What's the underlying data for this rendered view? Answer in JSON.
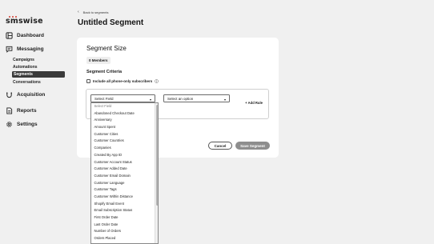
{
  "brand": {
    "logo_text": "smswise",
    "accent": "#d13b2f"
  },
  "sidebar": {
    "dashboard": "Dashboard",
    "messaging": "Messaging",
    "sub_items": [
      "Campaigns",
      "Automations",
      "Segments",
      "Conversations"
    ],
    "active_sub": "Segments",
    "acquisition": "Acquisition",
    "reports": "Reports",
    "settings": "Settings"
  },
  "header": {
    "back_label": "Back to segments",
    "title": "Untitled Segment"
  },
  "segment": {
    "size_title": "Segment Size",
    "members_badge": "0 Members",
    "criteria_title": "Segment Criteria",
    "phone_only_label": "Include all phone-only subscribers",
    "phone_only_checked": false,
    "field_select_value": "Select Field",
    "option_select_value": "Select an option",
    "add_rule_label": "+ Add Rule",
    "cancel_label": "Cancel",
    "save_label": "Save Segment"
  },
  "dropdown": {
    "options": [
      "Select Field",
      "Abandoned Checkout Date",
      "Anniversary",
      "Amount Spent",
      "Customer Cities",
      "Customer Countries",
      "Companies",
      "Created By App ID",
      "Customer Account Status",
      "Customer Added Date",
      "Customer Email Domain",
      "Customer Language",
      "Customer Tags",
      "Customer Within Distance",
      "Shopify Email Event",
      "Email Subscription Status",
      "First Order Date",
      "Last Order Date",
      "Number of Orders",
      "Orders Placed"
    ]
  },
  "icons": {
    "dashboard": "dashboard-icon",
    "messaging": "chat-icon",
    "acquisition": "magnet-icon",
    "reports": "document-icon",
    "settings": "gear-icon",
    "back": "chevron-left-icon",
    "info": "info-icon",
    "caret": "caret-down-icon"
  }
}
